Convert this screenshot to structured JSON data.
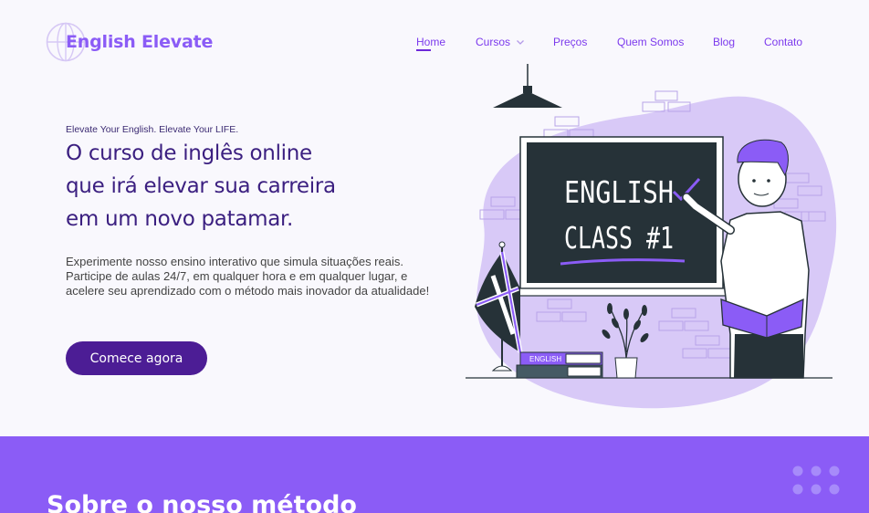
{
  "brand": {
    "name": "English Elevate"
  },
  "nav": {
    "items": [
      {
        "label": "Home",
        "active": true
      },
      {
        "label": "Cursos",
        "has_dropdown": true
      },
      {
        "label": "Preços"
      },
      {
        "label": "Quem Somos"
      },
      {
        "label": "Blog"
      },
      {
        "label": "Contato"
      }
    ]
  },
  "hero": {
    "tagline": "Elevate Your English. Elevate Your LIFE.",
    "headline_lines": [
      "O curso de inglês online",
      "que irá elevar sua carreira",
      "em um novo patamar."
    ],
    "description": "Experimente nosso ensino interativo que simula situações reais. Participe de aulas 24/7, em qualquer hora e em qualquer lugar, e acelere seu aprendizado com o método mais inovador da atualidade!",
    "cta_label": "Comece agora",
    "illustration": {
      "board_line1": "ENGLISH",
      "board_line2": "CLASS #1",
      "book_label": "ENGLISH"
    }
  },
  "section2": {
    "title": "Sobre o nosso método"
  },
  "colors": {
    "background": "#f9f8fd",
    "primary": "#8b5cf6",
    "primary_dark": "#4c1d95",
    "heading": "#3b1f80",
    "blob": "#d8c9f7",
    "board": "#263238"
  },
  "icons": {
    "logo": "globe-icon",
    "dropdown": "chevron-down-icon",
    "decoration": "dot-grid-icon"
  }
}
